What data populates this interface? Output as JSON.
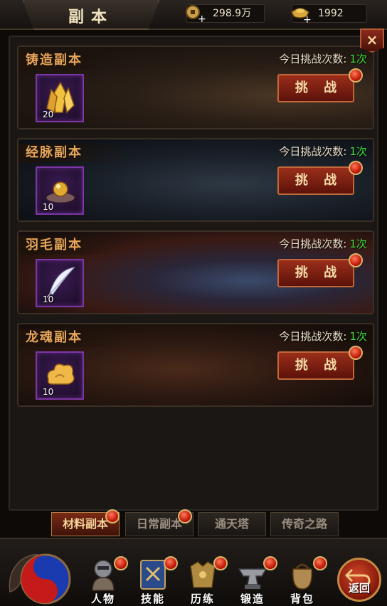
{
  "header": {
    "title": "副本",
    "gold": "298.9万",
    "ingot": "1992",
    "close_label": "×"
  },
  "dungeons": [
    {
      "name": "铸造副本",
      "attempts_label": "今日挑战次数:",
      "attempts": "1次",
      "button": "挑 战",
      "item_count": "20",
      "item_icon": "yellow-crystal-icon"
    },
    {
      "name": "经脉副本",
      "attempts_label": "今日挑战次数:",
      "attempts": "1次",
      "button": "挑 战",
      "item_count": "10",
      "item_icon": "golden-orb-icon"
    },
    {
      "name": "羽毛副本",
      "attempts_label": "今日挑战次数:",
      "attempts": "1次",
      "button": "挑 战",
      "item_count": "10",
      "item_icon": "white-feather-icon"
    },
    {
      "name": "龙魂副本",
      "attempts_label": "今日挑战次数:",
      "attempts": "1次",
      "button": "挑 战",
      "item_count": "10",
      "item_icon": "golden-cloud-icon"
    }
  ],
  "tabs": [
    {
      "label": "材料副本",
      "active": true
    },
    {
      "label": "日常副本",
      "active": false
    },
    {
      "label": "通天塔",
      "active": false
    },
    {
      "label": "传奇之路",
      "active": false
    }
  ],
  "nav": [
    {
      "label": "人物",
      "icon": "character-icon"
    },
    {
      "label": "技能",
      "icon": "skill-book-icon"
    },
    {
      "label": "历练",
      "icon": "armor-icon"
    },
    {
      "label": "锻造",
      "icon": "anvil-icon"
    },
    {
      "label": "背包",
      "icon": "bag-icon"
    }
  ],
  "back_label": "返回",
  "colors": {
    "accent": "#e5a55a",
    "attempts_green": "#3ee23e",
    "button_red": "#9a2e1a",
    "notify_dot": "#c41a0a"
  }
}
